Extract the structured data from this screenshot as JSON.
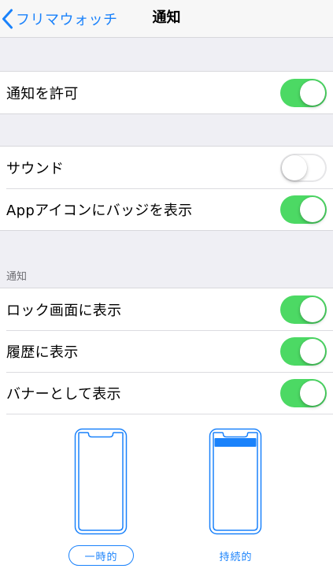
{
  "nav": {
    "back_label": "フリマウォッチ",
    "title": "通知"
  },
  "settings": {
    "allow_notifications": {
      "label": "通知を許可",
      "on": true
    },
    "sound": {
      "label": "サウンド",
      "on": false
    },
    "badge": {
      "label": "Appアイコンにバッジを表示",
      "on": true
    },
    "section_header": "通知",
    "lock_screen": {
      "label": "ロック画面に表示",
      "on": true
    },
    "history": {
      "label": "履歴に表示",
      "on": true
    },
    "banner": {
      "label": "バナーとして表示",
      "on": true
    }
  },
  "banner_style": {
    "temporary_label": "一時的",
    "persistent_label": "持続的",
    "selected": "一時的"
  },
  "colors": {
    "accent": "#1a82fb",
    "toggle_on": "#4cd964",
    "background": "#efeff4"
  }
}
